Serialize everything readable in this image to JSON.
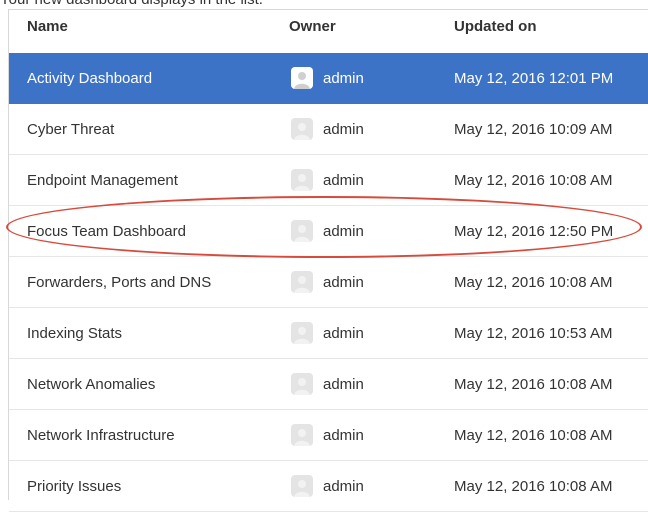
{
  "caption": "Your new dashboard displays in the list.",
  "table": {
    "headers": {
      "name": "Name",
      "owner": "Owner",
      "updated": "Updated on"
    },
    "rows": [
      {
        "name": "Activity Dashboard",
        "owner": "admin",
        "updated": "May 12, 2016 12:01 PM",
        "selected": true
      },
      {
        "name": "Cyber Threat",
        "owner": "admin",
        "updated": "May 12, 2016 10:09 AM"
      },
      {
        "name": "Endpoint Management",
        "owner": "admin",
        "updated": "May 12, 2016 10:08 AM"
      },
      {
        "name": "Focus Team Dashboard",
        "owner": "admin",
        "updated": "May 12, 2016 12:50 PM",
        "circled": true
      },
      {
        "name": "Forwarders, Ports and DNS",
        "owner": "admin",
        "updated": "May 12, 2016 10:08 AM"
      },
      {
        "name": "Indexing Stats",
        "owner": "admin",
        "updated": "May 12, 2016 10:53 AM"
      },
      {
        "name": "Network Anomalies",
        "owner": "admin",
        "updated": "May 12, 2016 10:08 AM"
      },
      {
        "name": "Network Infrastructure",
        "owner": "admin",
        "updated": "May 12, 2016 10:08 AM"
      },
      {
        "name": "Priority Issues",
        "owner": "admin",
        "updated": "May 12, 2016 10:08 AM"
      }
    ]
  },
  "colors": {
    "selected_row": "#3d73c7",
    "annotation_circle": "#d84a3b"
  },
  "icons": {
    "owner_avatar": "user-avatar-icon"
  }
}
